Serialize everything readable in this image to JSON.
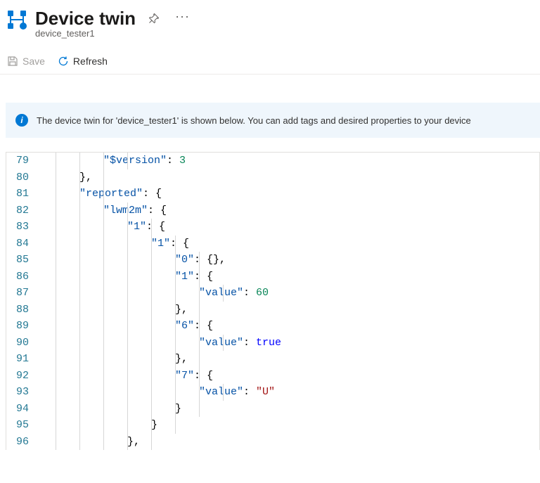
{
  "header": {
    "title": "Device twin",
    "subtitle": "device_tester1"
  },
  "toolbar": {
    "save": "Save",
    "refresh": "Refresh"
  },
  "info": {
    "text": "The device twin for 'device_tester1' is shown below. You can add tags and desired properties to your device"
  },
  "editor": {
    "lines": [
      {
        "num": "79",
        "indent_guides": 4,
        "indent_text": "        ",
        "tokens": [
          [
            "key",
            "\"$version\""
          ],
          [
            "punct",
            ": "
          ],
          [
            "num",
            "3"
          ]
        ]
      },
      {
        "num": "80",
        "indent_guides": 3,
        "indent_text": "    ",
        "tokens": [
          [
            "punct",
            "},"
          ]
        ]
      },
      {
        "num": "81",
        "indent_guides": 3,
        "indent_text": "    ",
        "tokens": [
          [
            "key",
            "\"reported\""
          ],
          [
            "punct",
            ": {"
          ]
        ]
      },
      {
        "num": "82",
        "indent_guides": 4,
        "indent_text": "        ",
        "tokens": [
          [
            "key",
            "\"lwm2m\""
          ],
          [
            "punct",
            ": {"
          ]
        ]
      },
      {
        "num": "83",
        "indent_guides": 5,
        "indent_text": "            ",
        "tokens": [
          [
            "key",
            "\"1\""
          ],
          [
            "punct",
            ": {"
          ]
        ]
      },
      {
        "num": "84",
        "indent_guides": 6,
        "indent_text": "                ",
        "tokens": [
          [
            "key",
            "\"1\""
          ],
          [
            "punct",
            ": {"
          ]
        ]
      },
      {
        "num": "85",
        "indent_guides": 7,
        "indent_text": "                    ",
        "tokens": [
          [
            "key",
            "\"0\""
          ],
          [
            "punct",
            ": {},"
          ]
        ]
      },
      {
        "num": "86",
        "indent_guides": 7,
        "indent_text": "                    ",
        "tokens": [
          [
            "key",
            "\"1\""
          ],
          [
            "punct",
            ": {"
          ]
        ]
      },
      {
        "num": "87",
        "indent_guides": 8,
        "indent_text": "                        ",
        "tokens": [
          [
            "key",
            "\"value\""
          ],
          [
            "punct",
            ": "
          ],
          [
            "num",
            "60"
          ]
        ]
      },
      {
        "num": "88",
        "indent_guides": 7,
        "indent_text": "                    ",
        "tokens": [
          [
            "punct",
            "},"
          ]
        ]
      },
      {
        "num": "89",
        "indent_guides": 7,
        "indent_text": "                    ",
        "tokens": [
          [
            "key",
            "\"6\""
          ],
          [
            "punct",
            ": {"
          ]
        ]
      },
      {
        "num": "90",
        "indent_guides": 8,
        "indent_text": "                        ",
        "tokens": [
          [
            "key",
            "\"value\""
          ],
          [
            "punct",
            ": "
          ],
          [
            "bool",
            "true"
          ]
        ]
      },
      {
        "num": "91",
        "indent_guides": 7,
        "indent_text": "                    ",
        "tokens": [
          [
            "punct",
            "},"
          ]
        ]
      },
      {
        "num": "92",
        "indent_guides": 7,
        "indent_text": "                    ",
        "tokens": [
          [
            "key",
            "\"7\""
          ],
          [
            "punct",
            ": {"
          ]
        ]
      },
      {
        "num": "93",
        "indent_guides": 8,
        "indent_text": "                        ",
        "tokens": [
          [
            "key",
            "\"value\""
          ],
          [
            "punct",
            ": "
          ],
          [
            "str",
            "\"U\""
          ]
        ]
      },
      {
        "num": "94",
        "indent_guides": 7,
        "indent_text": "                    ",
        "tokens": [
          [
            "punct",
            "}"
          ]
        ]
      },
      {
        "num": "95",
        "indent_guides": 6,
        "indent_text": "                ",
        "tokens": [
          [
            "punct",
            "}"
          ]
        ]
      },
      {
        "num": "96",
        "indent_guides": 5,
        "indent_text": "            ",
        "tokens": [
          [
            "punct",
            "},"
          ]
        ]
      }
    ]
  }
}
